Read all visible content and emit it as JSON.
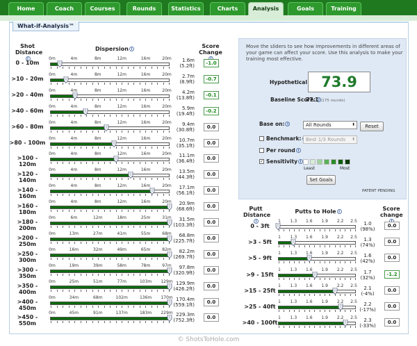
{
  "nav": {
    "tabs": [
      "Home",
      "Coach",
      "Courses",
      "Rounds",
      "Statistics",
      "Charts",
      "Analysis",
      "Goals",
      "Training"
    ],
    "active": "Analysis"
  },
  "section_tab": "What-if-Analysis™",
  "left": {
    "header_shot": "Shot Distance",
    "header_dispersion": "Dispersion",
    "header_change": "Score Change",
    "rows": [
      {
        "label": "0 - 10m",
        "ticks": [
          "0m",
          "4m",
          "8m",
          "12m",
          "16m",
          "20m"
        ],
        "max": 20,
        "value_m": "1.6m",
        "value_ft": "(5.2ft)",
        "position": 0.08,
        "change": "-1.0"
      },
      {
        "label": ">10 - 20m",
        "ticks": [
          "0m",
          "4m",
          "8m",
          "12m",
          "16m",
          "20m"
        ],
        "max": 20,
        "value_m": "2.7m",
        "value_ft": "(8.9ft)",
        "position": 0.135,
        "change": "-0.7"
      },
      {
        "label": ">20 - 40m",
        "ticks": [
          "0m",
          "4m",
          "8m",
          "12m",
          "16m",
          "20m"
        ],
        "max": 20,
        "value_m": "4.2m",
        "value_ft": "(13.8ft)",
        "position": 0.21,
        "change": "-0.1"
      },
      {
        "label": ">40 - 60m",
        "ticks": [
          "0m",
          "4m",
          "8m",
          "12m",
          "16m",
          "20m"
        ],
        "max": 20,
        "value_m": "5.9m",
        "value_ft": "(19.4ft)",
        "position": 0.295,
        "change": "-0.2"
      },
      {
        "label": ">60 - 80m",
        "ticks": [
          "0m",
          "4m",
          "8m",
          "12m",
          "16m",
          "20m"
        ],
        "max": 20,
        "value_m": "9.4m",
        "value_ft": "(30.8ft)",
        "position": 0.47,
        "change": "0.0"
      },
      {
        "label": ">80 - 100m",
        "ticks": [
          "0m",
          "4m",
          "8m",
          "12m",
          "16m",
          "20m"
        ],
        "max": 20,
        "value_m": "10.7m",
        "value_ft": "(35.1ft)",
        "position": 0.535,
        "change": "0.0"
      },
      {
        "label": ">100 - 120m",
        "ticks": [
          "0m",
          "4m",
          "8m",
          "12m",
          "16m",
          "20m"
        ],
        "max": 20,
        "value_m": "11.1m",
        "value_ft": "(36.4ft)",
        "position": 0.555,
        "change": "0.0"
      },
      {
        "label": ">120 - 140m",
        "ticks": [
          "0m",
          "4m",
          "8m",
          "12m",
          "16m",
          "20m"
        ],
        "max": 20,
        "value_m": "13.5m",
        "value_ft": "(44.3ft)",
        "position": 0.675,
        "change": "0.0"
      },
      {
        "label": ">140 - 160m",
        "ticks": [
          "0m",
          "4m",
          "8m",
          "12m",
          "16m",
          "20m"
        ],
        "max": 20,
        "value_m": "17.1m",
        "value_ft": "(56.1ft)",
        "position": 0.855,
        "change": "0.0"
      },
      {
        "label": ">160 - 180m",
        "ticks": [
          "0m",
          "4m",
          "8m",
          "12m",
          "16m",
          "20m"
        ],
        "max": 20,
        "value_m": "20.9m",
        "value_ft": "(68.6ft)",
        "position": 1.0,
        "change": "0.0"
      },
      {
        "label": ">180 - 200m",
        "ticks": [
          "0m",
          "6m",
          "12m",
          "18m",
          "25m",
          "31m"
        ],
        "max": 31,
        "value_m": "31.5m",
        "value_ft": "(103.3ft)",
        "position": 1.0,
        "change": "0.0"
      },
      {
        "label": ">200 - 250m",
        "ticks": [
          "0m",
          "13m",
          "27m",
          "41m",
          "55m",
          "68m"
        ],
        "max": 68,
        "value_m": "68.8m",
        "value_ft": "(225.7ft)",
        "position": 1.0,
        "change": "0.0"
      },
      {
        "label": ">250 - 300m",
        "ticks": [
          "0m",
          "16m",
          "32m",
          "49m",
          "65m",
          "82m"
        ],
        "max": 82,
        "value_m": "82.2m",
        "value_ft": "(269.7ft)",
        "position": 1.0,
        "change": "0.0"
      },
      {
        "label": ">300 - 350m",
        "ticks": [
          "0m",
          "19m",
          "39m",
          "58m",
          "78m",
          "97m"
        ],
        "max": 97,
        "value_m": "97.8m",
        "value_ft": "(320.9ft)",
        "position": 1.0,
        "change": "0.0"
      },
      {
        "label": ">350 - 400m",
        "ticks": [
          "0m",
          "25m",
          "51m",
          "77m",
          "103m",
          "129m"
        ],
        "max": 129,
        "value_m": "129.9m",
        "value_ft": "(426.2ft)",
        "position": 1.0,
        "change": "0.0"
      },
      {
        "label": ">400 - 450m",
        "ticks": [
          "0m",
          "34m",
          "68m",
          "102m",
          "136m",
          "170m"
        ],
        "max": 170,
        "value_m": "170.4m",
        "value_ft": "(559.1ft)",
        "position": 1.0,
        "change": "0.0"
      },
      {
        "label": ">450 - 550m",
        "ticks": [
          "0m",
          "45m",
          "91m",
          "137m",
          "183m",
          "229m"
        ],
        "max": 229,
        "value_m": "229.3m",
        "value_ft": "(752.3ft)",
        "position": 1.0,
        "change": "0.0"
      }
    ]
  },
  "right": {
    "intro": "Move the sliders to see how improvements in different areas of your game can affect your score. Use this analysis to make your training most effective.",
    "hypothetical_label": "Hypothetical Score:",
    "hypothetical_value": "73.9",
    "baseline_label": "Baseline Score:",
    "baseline_value": "77.1",
    "baseline_rounds": "(175 rounds)",
    "base_on_label": "Base on:",
    "base_on_value": "All Rounds",
    "reset_label": "Reset",
    "benchmark_label": "Benchmark:",
    "benchmark_value": "Best 1/3 Rounds",
    "per_round_label": "Per round",
    "sensitivity_label": "Sensitivity",
    "sensitivity_least": "Least",
    "sensitivity_most": "Most",
    "sensitivity_colors": [
      "#ffffff",
      "#d6ecd6",
      "#9fd39f",
      "#58b058",
      "#2a8a2a",
      "#0d5e0d",
      "#073a07"
    ],
    "set_goals_label": "Set Goals",
    "patent": "PATENT PENDING"
  },
  "putt": {
    "header_distance": "Putt Distance",
    "header_putts": "Putts to Hole",
    "header_change": "Score change",
    "ticks": [
      "1",
      "1.3",
      "1.6",
      "1.9",
      "2.2",
      "2.5"
    ],
    "rows": [
      {
        "label": "0 - 3ft",
        "value": "1.0",
        "pct": "(98%)",
        "position": 0.0,
        "change": "0.0"
      },
      {
        "label": ">3 - 5ft",
        "value": "1.3",
        "pct": "(74%)",
        "position": 0.2,
        "change": "0.0"
      },
      {
        "label": ">5 - 9ft",
        "value": "1.6",
        "pct": "(42%)",
        "position": 0.4,
        "change": "0.0"
      },
      {
        "label": ">9 - 15ft",
        "value": "1.7",
        "pct": "(32%)",
        "position": 0.47,
        "change": "-1.2"
      },
      {
        "label": ">15 - 25ft",
        "value": "2.1",
        "pct": "(-4%)",
        "position": 0.73,
        "change": "0.0"
      },
      {
        "label": ">25 - 40ft",
        "value": "2.2",
        "pct": "(-17%)",
        "position": 0.8,
        "change": "0.0"
      },
      {
        "label": ">40 - 100ft",
        "value": "2.3",
        "pct": "(-33%)",
        "position": 0.87,
        "change": "0.0"
      }
    ]
  },
  "footer": "© ShotsToHole.com"
}
